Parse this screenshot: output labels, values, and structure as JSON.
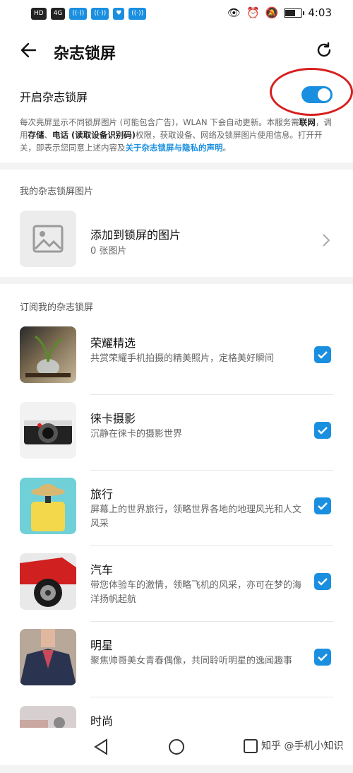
{
  "status_bar": {
    "left_badges": [
      "HD",
      "4G",
      "wifi",
      "wifi",
      "health",
      "wifi"
    ],
    "time": "4:03",
    "battery_level": 0.55
  },
  "header": {
    "title": "杂志锁屏"
  },
  "toggle": {
    "label": "开启杂志锁屏",
    "on": true
  },
  "description": {
    "p1": "每次亮屏显示不同锁屏图片 (可能包含广告)，WLAN 下会自动更新。本服务需",
    "b1": "联网",
    "p2": "，调用",
    "b2": "存储",
    "p3": "、",
    "b3": "电话 (读取设备识别码)",
    "p4": "权限，获取设备、网络及锁屏图片使用信息。打开开关，即表示您同意上述内容及",
    "link": "关于杂志锁屏与隐私的声明",
    "p5": "。"
  },
  "my_images": {
    "section_title": "我的杂志锁屏图片",
    "add_label": "添加到锁屏的图片",
    "count": "0 张图片"
  },
  "subscriptions": {
    "section_title": "订阅我的杂志锁屏",
    "items": [
      {
        "title": "荣耀精选",
        "desc": "共赏荣耀手机拍摄的精美照片，定格美好瞬间",
        "checked": true
      },
      {
        "title": "徕卡摄影",
        "desc": "沉静在徕卡的摄影世界",
        "checked": true
      },
      {
        "title": "旅行",
        "desc": "屏幕上的世界旅行，领略世界各地的地理风光和人文风采",
        "checked": true
      },
      {
        "title": "汽车",
        "desc": "带您体验车的激情，领略飞机的风采，亦可在梦的海洋扬帆起航",
        "checked": true
      },
      {
        "title": "明星",
        "desc": "聚焦帅哥美女青春偶像，共同聆听明星的逸闻趣事",
        "checked": true
      },
      {
        "title": "时尚",
        "desc": "",
        "checked": true
      }
    ]
  },
  "watermark": "知乎 @手机小知识",
  "colors": {
    "accent": "#1a8fe0",
    "annotation_red": "#d81e1e"
  }
}
